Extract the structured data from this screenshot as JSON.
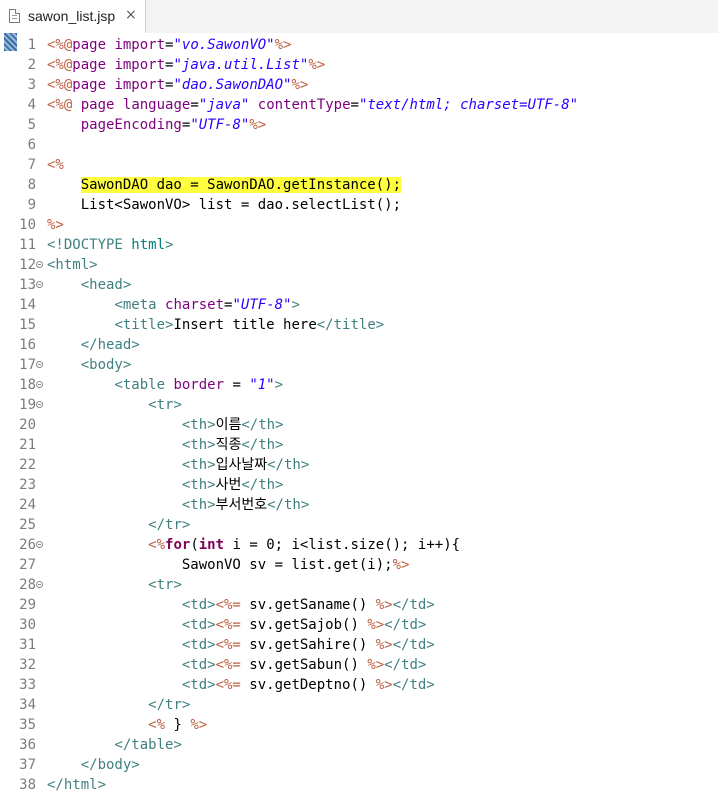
{
  "tab": {
    "title": "sawon_list.jsp",
    "close": "×",
    "icon": "jsp-file-icon"
  },
  "colors": {
    "delimiter": "#bf5f3f",
    "attribute": "#7f007f",
    "string": "#2a00ff",
    "tag": "#3f7f7f",
    "keyword": "#7f0055",
    "doctype": "#008080",
    "highlight": "#ffff3f",
    "line_number": "#7c7c7c"
  },
  "lines": [
    {
      "n": "1",
      "fold": false,
      "hl": false,
      "indent": 0,
      "tokens": [
        [
          "delim",
          "<%@"
        ],
        [
          "attr",
          "page "
        ],
        [
          "attr",
          "import"
        ],
        [
          "plain",
          "="
        ],
        [
          "str",
          "\"vo.SawonVO\""
        ],
        [
          "delim",
          "%>"
        ]
      ]
    },
    {
      "n": "2",
      "fold": false,
      "hl": false,
      "indent": 0,
      "tokens": [
        [
          "delim",
          "<%@"
        ],
        [
          "attr",
          "page "
        ],
        [
          "attr",
          "import"
        ],
        [
          "plain",
          "="
        ],
        [
          "str",
          "\"java.util.List\""
        ],
        [
          "delim",
          "%>"
        ]
      ]
    },
    {
      "n": "3",
      "fold": false,
      "hl": false,
      "indent": 0,
      "tokens": [
        [
          "delim",
          "<%@"
        ],
        [
          "attr",
          "page "
        ],
        [
          "attr",
          "import"
        ],
        [
          "plain",
          "="
        ],
        [
          "str",
          "\"dao.SawonDAO\""
        ],
        [
          "delim",
          "%>"
        ]
      ]
    },
    {
      "n": "4",
      "fold": false,
      "hl": false,
      "indent": 0,
      "tokens": [
        [
          "delim",
          "<%@"
        ],
        [
          "plain",
          " "
        ],
        [
          "attr",
          "page "
        ],
        [
          "attr",
          "language"
        ],
        [
          "plain",
          "="
        ],
        [
          "str",
          "\"java\""
        ],
        [
          "plain",
          " "
        ],
        [
          "attr",
          "contentType"
        ],
        [
          "plain",
          "="
        ],
        [
          "str",
          "\"text/html; charset=UTF-8\""
        ]
      ]
    },
    {
      "n": "5",
      "fold": false,
      "hl": false,
      "indent": 4,
      "tokens": [
        [
          "attr",
          "pageEncoding"
        ],
        [
          "plain",
          "="
        ],
        [
          "str",
          "\"UTF-8\""
        ],
        [
          "delim",
          "%>"
        ]
      ]
    },
    {
      "n": "6",
      "fold": false,
      "hl": false,
      "indent": 0,
      "tokens": []
    },
    {
      "n": "7",
      "fold": false,
      "hl": false,
      "indent": 0,
      "tokens": [
        [
          "delim",
          "<%"
        ]
      ]
    },
    {
      "n": "8",
      "fold": false,
      "hl": true,
      "indent": 4,
      "tokens": [
        [
          "plain",
          "SawonDAO dao = SawonDAO.getInstance();"
        ]
      ]
    },
    {
      "n": "9",
      "fold": false,
      "hl": false,
      "indent": 4,
      "tokens": [
        [
          "plain",
          "List<SawonVO> list = dao.selectList();"
        ]
      ]
    },
    {
      "n": "10",
      "fold": false,
      "hl": false,
      "indent": 0,
      "tokens": [
        [
          "delim",
          "%>"
        ]
      ]
    },
    {
      "n": "11",
      "fold": false,
      "hl": false,
      "indent": 0,
      "tokens": [
        [
          "tag",
          "<!DOCTYPE "
        ],
        [
          "doc",
          "html"
        ],
        [
          "tag",
          ">"
        ]
      ]
    },
    {
      "n": "12",
      "fold": true,
      "hl": false,
      "indent": 0,
      "tokens": [
        [
          "tag",
          "<html>"
        ]
      ]
    },
    {
      "n": "13",
      "fold": true,
      "hl": false,
      "indent": 4,
      "tokens": [
        [
          "tag",
          "<head>"
        ]
      ]
    },
    {
      "n": "14",
      "fold": false,
      "hl": false,
      "indent": 8,
      "tokens": [
        [
          "tag",
          "<meta"
        ],
        [
          "plain",
          " "
        ],
        [
          "attr",
          "charset"
        ],
        [
          "plain",
          "="
        ],
        [
          "str",
          "\"UTF-8\""
        ],
        [
          "tag",
          ">"
        ]
      ]
    },
    {
      "n": "15",
      "fold": false,
      "hl": false,
      "indent": 8,
      "tokens": [
        [
          "tag",
          "<title>"
        ],
        [
          "plain",
          "Insert title here"
        ],
        [
          "tag",
          "</title>"
        ]
      ]
    },
    {
      "n": "16",
      "fold": false,
      "hl": false,
      "indent": 4,
      "tokens": [
        [
          "tag",
          "</head>"
        ]
      ]
    },
    {
      "n": "17",
      "fold": true,
      "hl": false,
      "indent": 4,
      "tokens": [
        [
          "tag",
          "<body>"
        ]
      ]
    },
    {
      "n": "18",
      "fold": true,
      "hl": false,
      "indent": 8,
      "tokens": [
        [
          "tag",
          "<table"
        ],
        [
          "plain",
          " "
        ],
        [
          "attr",
          "border"
        ],
        [
          "plain",
          " = "
        ],
        [
          "str",
          "\"1\""
        ],
        [
          "tag",
          ">"
        ]
      ]
    },
    {
      "n": "19",
      "fold": true,
      "hl": false,
      "indent": 12,
      "tokens": [
        [
          "tag",
          "<tr>"
        ]
      ]
    },
    {
      "n": "20",
      "fold": false,
      "hl": false,
      "indent": 16,
      "tokens": [
        [
          "tag",
          "<th>"
        ],
        [
          "plain",
          "이름"
        ],
        [
          "tag",
          "</th>"
        ]
      ]
    },
    {
      "n": "21",
      "fold": false,
      "hl": false,
      "indent": 16,
      "tokens": [
        [
          "tag",
          "<th>"
        ],
        [
          "plain",
          "직종"
        ],
        [
          "tag",
          "</th>"
        ]
      ]
    },
    {
      "n": "22",
      "fold": false,
      "hl": false,
      "indent": 16,
      "tokens": [
        [
          "tag",
          "<th>"
        ],
        [
          "plain",
          "입사날짜"
        ],
        [
          "tag",
          "</th>"
        ]
      ]
    },
    {
      "n": "23",
      "fold": false,
      "hl": false,
      "indent": 16,
      "tokens": [
        [
          "tag",
          "<th>"
        ],
        [
          "plain",
          "사번"
        ],
        [
          "tag",
          "</th>"
        ]
      ]
    },
    {
      "n": "24",
      "fold": false,
      "hl": false,
      "indent": 16,
      "tokens": [
        [
          "tag",
          "<th>"
        ],
        [
          "plain",
          "부서번호"
        ],
        [
          "tag",
          "</th>"
        ]
      ]
    },
    {
      "n": "25",
      "fold": false,
      "hl": false,
      "indent": 12,
      "tokens": [
        [
          "tag",
          "</tr>"
        ]
      ]
    },
    {
      "n": "26",
      "fold": true,
      "hl": false,
      "indent": 12,
      "tokens": [
        [
          "delim",
          "<%"
        ],
        [
          "kw",
          "for"
        ],
        [
          "plain",
          "("
        ],
        [
          "kw",
          "int"
        ],
        [
          "plain",
          " i = 0; i<list.size(); i++){"
        ]
      ]
    },
    {
      "n": "27",
      "fold": false,
      "hl": false,
      "indent": 16,
      "tokens": [
        [
          "plain",
          "SawonVO sv = list.get(i);"
        ],
        [
          "delim",
          "%>"
        ]
      ]
    },
    {
      "n": "28",
      "fold": true,
      "hl": false,
      "indent": 12,
      "tokens": [
        [
          "tag",
          "<tr>"
        ]
      ]
    },
    {
      "n": "29",
      "fold": false,
      "hl": false,
      "indent": 16,
      "tokens": [
        [
          "tag",
          "<td>"
        ],
        [
          "delim",
          "<%="
        ],
        [
          "plain",
          " sv.getSaname() "
        ],
        [
          "delim",
          "%>"
        ],
        [
          "tag",
          "</td>"
        ]
      ]
    },
    {
      "n": "30",
      "fold": false,
      "hl": false,
      "indent": 16,
      "tokens": [
        [
          "tag",
          "<td>"
        ],
        [
          "delim",
          "<%="
        ],
        [
          "plain",
          " sv.getSajob() "
        ],
        [
          "delim",
          "%>"
        ],
        [
          "tag",
          "</td>"
        ]
      ]
    },
    {
      "n": "31",
      "fold": false,
      "hl": false,
      "indent": 16,
      "tokens": [
        [
          "tag",
          "<td>"
        ],
        [
          "delim",
          "<%="
        ],
        [
          "plain",
          " sv.getSahire() "
        ],
        [
          "delim",
          "%>"
        ],
        [
          "tag",
          "</td>"
        ]
      ]
    },
    {
      "n": "32",
      "fold": false,
      "hl": false,
      "indent": 16,
      "tokens": [
        [
          "tag",
          "<td>"
        ],
        [
          "delim",
          "<%="
        ],
        [
          "plain",
          " sv.getSabun() "
        ],
        [
          "delim",
          "%>"
        ],
        [
          "tag",
          "</td>"
        ]
      ]
    },
    {
      "n": "33",
      "fold": false,
      "hl": false,
      "indent": 16,
      "tokens": [
        [
          "tag",
          "<td>"
        ],
        [
          "delim",
          "<%="
        ],
        [
          "plain",
          " sv.getDeptno() "
        ],
        [
          "delim",
          "%>"
        ],
        [
          "tag",
          "</td>"
        ]
      ]
    },
    {
      "n": "34",
      "fold": false,
      "hl": false,
      "indent": 12,
      "tokens": [
        [
          "tag",
          "</tr>"
        ]
      ]
    },
    {
      "n": "35",
      "fold": false,
      "hl": false,
      "indent": 12,
      "tokens": [
        [
          "delim",
          "<%"
        ],
        [
          "plain",
          " } "
        ],
        [
          "delim",
          "%>"
        ]
      ]
    },
    {
      "n": "36",
      "fold": false,
      "hl": false,
      "indent": 8,
      "tokens": [
        [
          "tag",
          "</table>"
        ]
      ]
    },
    {
      "n": "37",
      "fold": false,
      "hl": false,
      "indent": 4,
      "tokens": [
        [
          "tag",
          "</body>"
        ]
      ]
    },
    {
      "n": "38",
      "fold": false,
      "hl": false,
      "indent": 0,
      "tokens": [
        [
          "tag",
          "</html>"
        ]
      ]
    }
  ]
}
